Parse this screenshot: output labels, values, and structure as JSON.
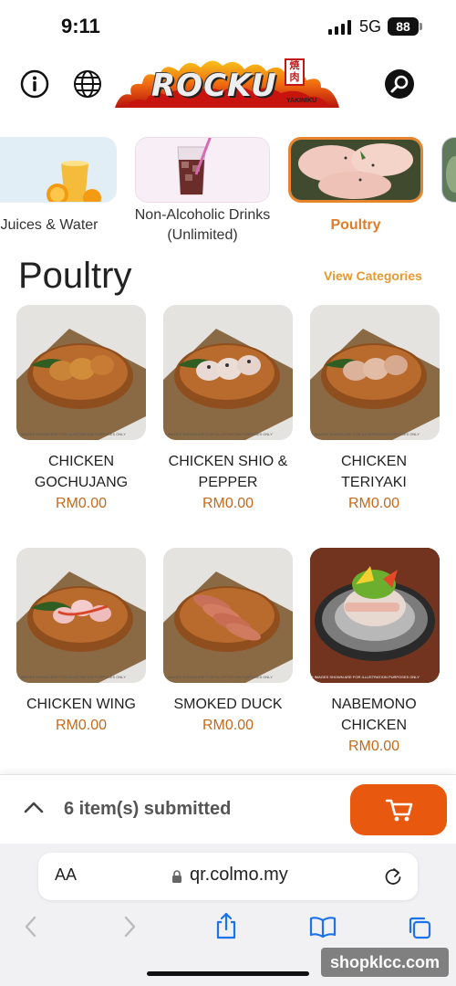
{
  "status_bar": {
    "time": "9:11",
    "network": "5G",
    "battery": "88"
  },
  "header": {
    "logo_text": "ROCKU",
    "logo_subtitle": "YAKINIKU",
    "logo_kanji": "焼肉"
  },
  "categories": [
    {
      "label": "Juices & Water",
      "active": false
    },
    {
      "label": "Non-Alcoholic Drinks (Unlimited)",
      "active": false
    },
    {
      "label": "Poultry",
      "active": true
    }
  ],
  "section": {
    "title": "Poultry",
    "view_categories": "View Categories"
  },
  "products": [
    {
      "name": "CHICKEN GOCHUJANG",
      "price": "RM0.00",
      "disclaimer": "* IMAGES SHOWN ARE FOR ILLUSTRATION PURPOSES ONLY"
    },
    {
      "name": "CHICKEN SHIO & PEPPER",
      "price": "RM0.00",
      "disclaimer": "* IMAGES SHOWN ARE FOR ILLUSTRATION PURPOSES ONLY"
    },
    {
      "name": "CHICKEN TERIYAKI",
      "price": "RM0.00",
      "disclaimer": "* IMAGES SHOWN ARE FOR ILLUSTRATION PURPOSES ONLY"
    },
    {
      "name": "CHICKEN WING",
      "price": "RM0.00",
      "disclaimer": "* IMAGES SHOWN ARE FOR ILLUSTRATION PURPOSES ONLY"
    },
    {
      "name": "SMOKED DUCK",
      "price": "RM0.00",
      "disclaimer": "* IMAGES SHOWN ARE FOR ILLUSTRATION PURPOSES ONLY"
    },
    {
      "name": "NABEMONO CHICKEN",
      "price": "RM0.00",
      "disclaimer": "* IMAGES SHOWN ARE FOR ILLUSTRATION PURPOSES ONLY"
    }
  ],
  "cart": {
    "submitted_text": "6 item(s) submitted"
  },
  "browser": {
    "text_size": "AA",
    "url": "qr.colmo.my"
  },
  "watermark": "shopklcc.com",
  "colors": {
    "accent": "#e07b2a",
    "cart_button": "#e8590f",
    "price": "#c46a1c"
  }
}
